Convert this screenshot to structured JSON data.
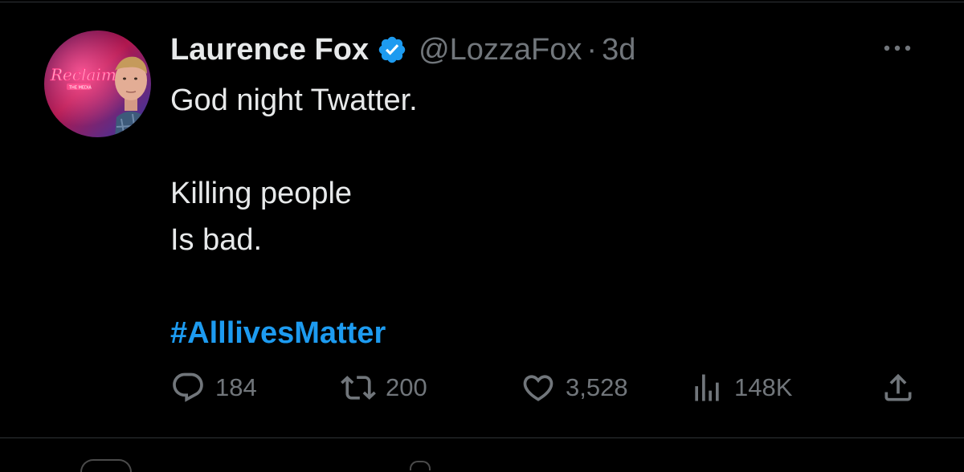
{
  "tweet": {
    "author_name": "Laurence Fox",
    "handle": "@LozzaFox",
    "separator": "·",
    "time": "3d",
    "lines": [
      "God night Twatter.",
      "",
      "Killing people",
      "Is bad.",
      ""
    ],
    "hashtag": "#AlllivesMatter",
    "avatar_sign_text": "Reclaim",
    "avatar_sign_subtext": "THE MEDIA"
  },
  "actions": {
    "replies": "184",
    "reposts": "200",
    "likes": "3,528",
    "views": "148K"
  },
  "icons": {
    "verified": "verified-badge-icon",
    "more": "more-icon",
    "reply": "reply-icon",
    "repost": "repost-icon",
    "like": "heart-icon",
    "views": "views-icon",
    "share": "share-icon"
  },
  "colors": {
    "background": "#000000",
    "text": "#e7e9ea",
    "muted": "#71767b",
    "accent": "#1d9bf0",
    "divider": "#2f3336"
  }
}
